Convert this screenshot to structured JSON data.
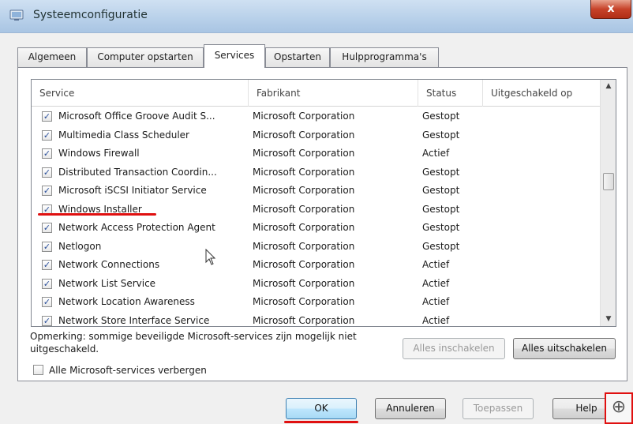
{
  "window": {
    "title": "Systeemconfiguratie",
    "close_glyph": "x"
  },
  "tabs": [
    {
      "label": "Algemeen",
      "active": false
    },
    {
      "label": "Computer opstarten",
      "active": false
    },
    {
      "label": "Services",
      "active": true
    },
    {
      "label": "Opstarten",
      "active": false
    },
    {
      "label": "Hulpprogramma's",
      "active": false
    }
  ],
  "list": {
    "columns": [
      "Service",
      "Fabrikant",
      "Status",
      "Uitgeschakeld op"
    ],
    "rows": [
      {
        "checked": true,
        "name": "Microsoft Office Groove Audit S...",
        "manufacturer": "Microsoft Corporation",
        "status": "Gestopt",
        "disabled_on": ""
      },
      {
        "checked": true,
        "name": "Multimedia Class Scheduler",
        "manufacturer": "Microsoft Corporation",
        "status": "Gestopt",
        "disabled_on": ""
      },
      {
        "checked": true,
        "name": "Windows Firewall",
        "manufacturer": "Microsoft Corporation",
        "status": "Actief",
        "disabled_on": ""
      },
      {
        "checked": true,
        "name": "Distributed Transaction Coordin...",
        "manufacturer": "Microsoft Corporation",
        "status": "Gestopt",
        "disabled_on": ""
      },
      {
        "checked": true,
        "name": "Microsoft iSCSI Initiator Service",
        "manufacturer": "Microsoft Corporation",
        "status": "Gestopt",
        "disabled_on": ""
      },
      {
        "checked": true,
        "name": "Windows Installer",
        "manufacturer": "Microsoft Corporation",
        "status": "Gestopt",
        "disabled_on": ""
      },
      {
        "checked": true,
        "name": "Network Access Protection Agent",
        "manufacturer": "Microsoft Corporation",
        "status": "Gestopt",
        "disabled_on": ""
      },
      {
        "checked": true,
        "name": "Netlogon",
        "manufacturer": "Microsoft Corporation",
        "status": "Gestopt",
        "disabled_on": ""
      },
      {
        "checked": true,
        "name": "Network Connections",
        "manufacturer": "Microsoft Corporation",
        "status": "Actief",
        "disabled_on": ""
      },
      {
        "checked": true,
        "name": "Network List Service",
        "manufacturer": "Microsoft Corporation",
        "status": "Actief",
        "disabled_on": ""
      },
      {
        "checked": true,
        "name": "Network Location Awareness",
        "manufacturer": "Microsoft Corporation",
        "status": "Actief",
        "disabled_on": ""
      },
      {
        "checked": true,
        "name": "Network Store Interface Service",
        "manufacturer": "Microsoft Corporation",
        "status": "Actief",
        "disabled_on": ""
      }
    ],
    "scroll_up_glyph": "▲",
    "scroll_down_glyph": "▼"
  },
  "note": "Opmerking: sommige beveiligde Microsoft-services zijn mogelijk niet uitgeschakeld.",
  "buttons": {
    "enable_all": "Alles inschakelen",
    "disable_all": "Alles uitschakelen",
    "ok": "OK",
    "cancel": "Annuleren",
    "apply": "Toepassen",
    "help": "Help"
  },
  "hide_ms_label": "Alle Microsoft-services verbergen",
  "check_glyph": "✓",
  "zoom_glyph": "⊕",
  "colors": {
    "highlight_red": "#e01010"
  }
}
